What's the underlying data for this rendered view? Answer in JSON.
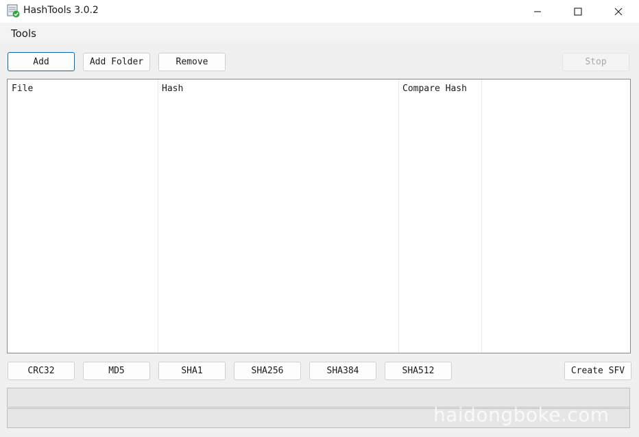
{
  "window": {
    "title": "HashTools 3.0.2",
    "icon": "hashtools-app-icon",
    "controls": [
      "minimize-icon",
      "maximize-icon",
      "close-icon"
    ]
  },
  "menu": {
    "tools": "Tools"
  },
  "toolbar": {
    "add": "Add",
    "add_folder": "Add Folder",
    "remove": "Remove",
    "stop": "Stop"
  },
  "list": {
    "columns": [
      "File",
      "Hash",
      "Compare Hash",
      ""
    ]
  },
  "hash_buttons": {
    "crc32": "CRC32",
    "md5": "MD5",
    "sha1": "SHA1",
    "sha256": "SHA256",
    "sha384": "SHA384",
    "sha512": "SHA512",
    "create_sfv": "Create SFV"
  },
  "watermark": "haidongboke.com",
  "colors": {
    "accent": "#0067c0",
    "list_border": "#828790"
  }
}
